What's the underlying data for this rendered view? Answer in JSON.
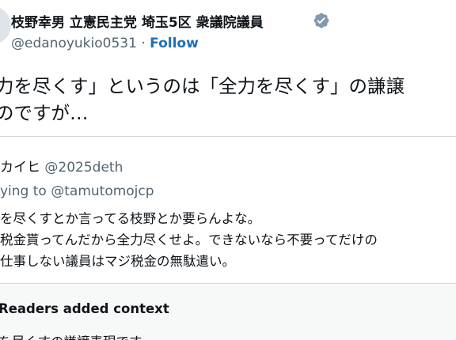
{
  "author": {
    "name": "枝野幸男 立憲民主党 埼玉5区 衆議院議員",
    "handle": "@edanoyukio0531",
    "separator": "·",
    "follow_label": "Follow",
    "verified_icon": "verified-badge-icon",
    "verified_color": "#829aab"
  },
  "tweet": {
    "line1": "力を尽くす」というのは「全力を尽くす」の謙譲",
    "line2": "のですが…"
  },
  "quote": {
    "author_name": "カイヒ",
    "author_handle": "@2025deth",
    "reply_prefix": "ying to",
    "reply_handle": "@tamutomojcp",
    "lines": [
      "を尽くすとか言ってる枝野とか要らんよな。",
      "税金貰ってんだから全力尽くせよ。できないなら不要ってだけの",
      "仕事しない議員はマジ税金の無駄遣い。"
    ]
  },
  "context": {
    "title": "Readers added context",
    "text": "を尽くすの謙譲表現です。"
  },
  "colors": {
    "text": "#0f1419",
    "secondary": "#536471",
    "link": "#1d6fb8",
    "border": "#cfd9de",
    "context_bg": "#f7f9f9"
  }
}
